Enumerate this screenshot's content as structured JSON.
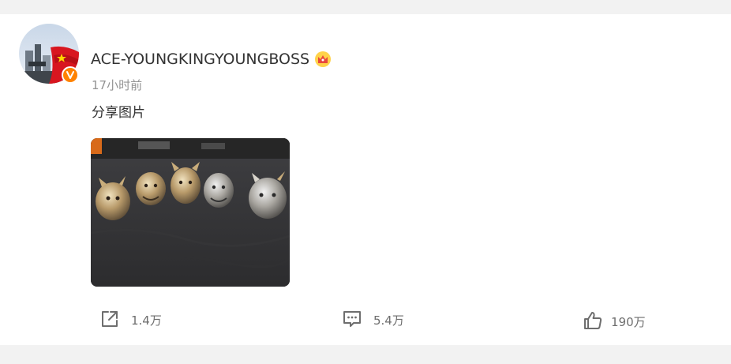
{
  "post": {
    "username": "ACE-YOUNGKINGYOUNGBOSS",
    "timestamp": "17小时前",
    "text": "分享图片",
    "image_alt": "dragon-head rings",
    "avatar_icon": "avatar-photo",
    "verified_icon": "verified-v-badge",
    "crown_icon": "crown-icon"
  },
  "actions": {
    "share": {
      "label": "1.4万",
      "icon": "share-icon"
    },
    "comment": {
      "label": "5.4万",
      "icon": "comment-icon"
    },
    "like": {
      "label": "190万",
      "icon": "thumbs-up-icon"
    }
  },
  "colors": {
    "accent": "#ff8200",
    "text_primary": "#333333",
    "text_secondary": "#939393",
    "background": "#f2f2f2"
  }
}
